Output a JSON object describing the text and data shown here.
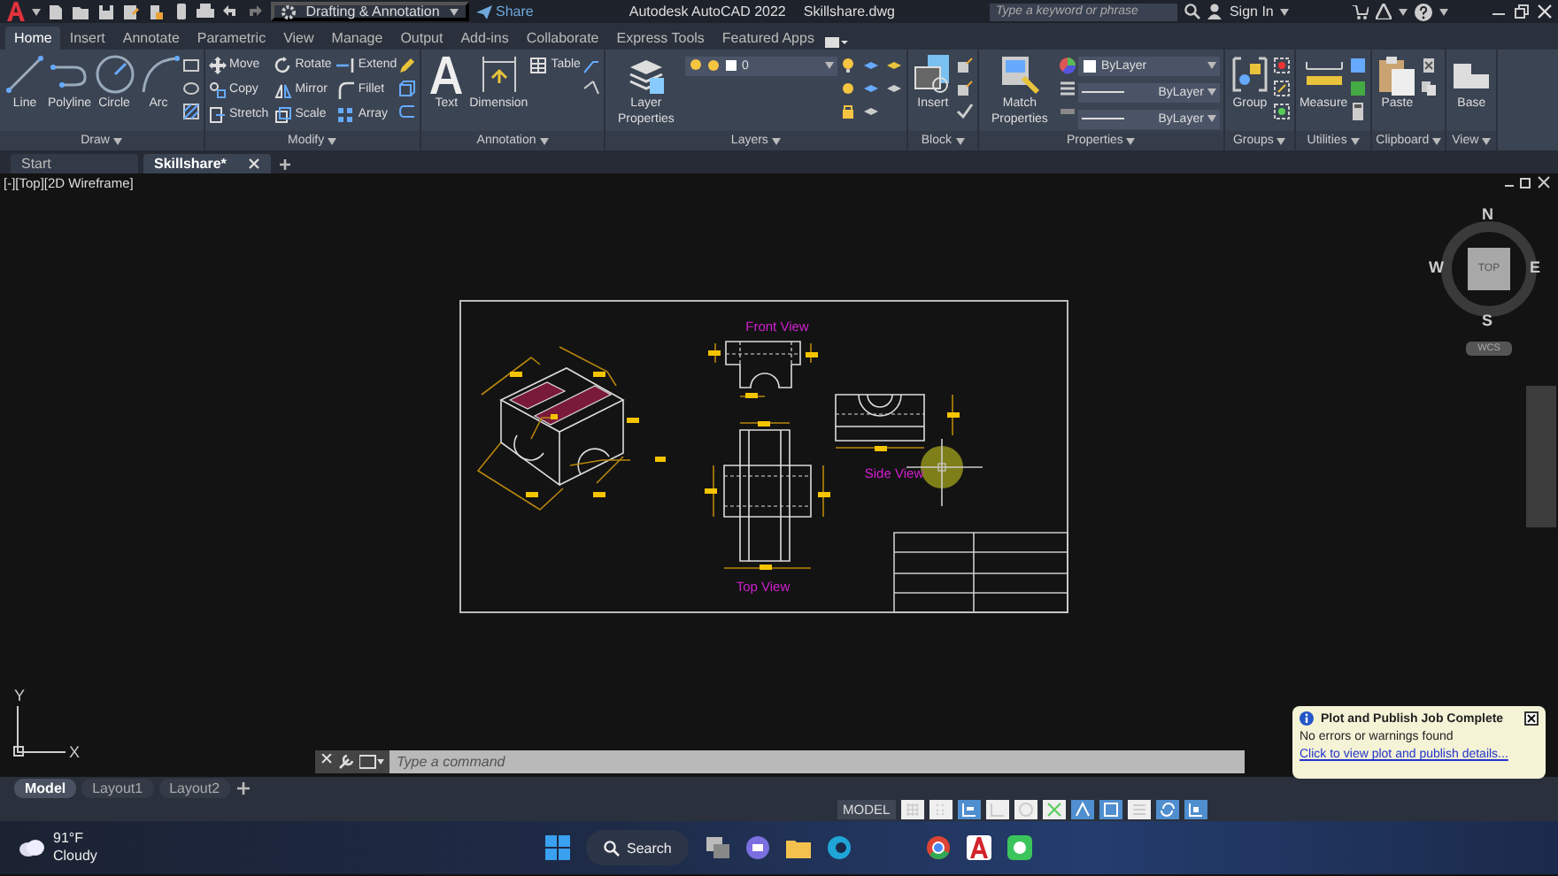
{
  "title_bar": {
    "workspace": "Drafting & Annotation",
    "share": "Share",
    "app_title": "Autodesk AutoCAD 2022",
    "file_name": "Skillshare.dwg",
    "search": {
      "placeholder": "Type a keyword or phrase"
    },
    "sign_in": "Sign In"
  },
  "ribbon_tabs": [
    {
      "label": "Home",
      "selected": true
    },
    {
      "label": "Insert",
      "selected": false
    },
    {
      "label": "Annotate",
      "selected": false
    },
    {
      "label": "Parametric",
      "selected": false
    },
    {
      "label": "View",
      "selected": false
    },
    {
      "label": "Manage",
      "selected": false
    },
    {
      "label": "Output",
      "selected": false
    },
    {
      "label": "Add-ins",
      "selected": false
    },
    {
      "label": "Collaborate",
      "selected": false
    },
    {
      "label": "Express Tools",
      "selected": false
    },
    {
      "label": "Featured Apps",
      "selected": false
    }
  ],
  "ribbon_panels": [
    {
      "title": "Draw",
      "tools": [
        {
          "kind": "large",
          "label": "Line"
        },
        {
          "kind": "large",
          "label": "Polyline"
        },
        {
          "kind": "large",
          "label": "Circle"
        },
        {
          "kind": "large",
          "label": "Arc"
        }
      ]
    },
    {
      "title": "Modify",
      "tools": [
        {
          "kind": "small",
          "label": "Move"
        },
        {
          "kind": "small",
          "label": "Rotate"
        },
        {
          "kind": "small",
          "label": "Extend"
        },
        {
          "kind": "small",
          "label": "Copy"
        },
        {
          "kind": "small",
          "label": "Mirror"
        },
        {
          "kind": "small",
          "label": "Fillet"
        },
        {
          "kind": "small",
          "label": "Stretch"
        },
        {
          "kind": "small",
          "label": "Scale"
        },
        {
          "kind": "small",
          "label": "Array"
        }
      ]
    },
    {
      "title": "Annotation",
      "tools": [
        {
          "kind": "large",
          "label": "Text"
        },
        {
          "kind": "large",
          "label": "Dimension"
        },
        {
          "kind": "small",
          "label": "Table"
        }
      ]
    },
    {
      "title": "Layers",
      "tools": [
        {
          "kind": "large",
          "label": "Layer Properties"
        },
        {
          "kind": "combo",
          "label": "0"
        }
      ]
    },
    {
      "title": "Block",
      "tools": [
        {
          "kind": "large",
          "label": "Insert"
        }
      ]
    },
    {
      "title": "Properties",
      "tools": [
        {
          "kind": "large",
          "label": "Match Properties"
        },
        {
          "kind": "combo",
          "label": "ByLayer"
        },
        {
          "kind": "combo",
          "label": "ByLayer"
        },
        {
          "kind": "combo",
          "label": "ByLayer"
        }
      ]
    },
    {
      "title": "Groups",
      "tools": [
        {
          "kind": "large",
          "label": "Group"
        }
      ]
    },
    {
      "title": "Utilities",
      "tools": [
        {
          "kind": "large",
          "label": "Measure"
        }
      ]
    },
    {
      "title": "Clipboard",
      "tools": [
        {
          "kind": "large",
          "label": "Paste"
        }
      ]
    },
    {
      "title": "View",
      "tools": [
        {
          "kind": "large",
          "label": "Base"
        }
      ]
    }
  ],
  "file_tabs": [
    {
      "label": "Start",
      "selected": false
    },
    {
      "label": "Skillshare*",
      "selected": true
    }
  ],
  "viewport": {
    "label": "[-][Top][2D Wireframe]",
    "view_labels": [
      "Front View",
      "Side View",
      "Top View"
    ],
    "viewcube": {
      "face": "TOP",
      "north": "N",
      "south": "S",
      "east": "E",
      "west": "W",
      "ucs": "WCS"
    },
    "axes": {
      "x": "X",
      "y": "Y"
    }
  },
  "command_line": {
    "placeholder": "Type a command"
  },
  "notification": {
    "title": "Plot and Publish Job Complete",
    "message": "No errors or warnings found",
    "link": "Click to view plot and publish details..."
  },
  "layout_tabs": [
    {
      "label": "Model",
      "selected": true
    },
    {
      "label": "Layout1",
      "selected": false
    },
    {
      "label": "Layout2",
      "selected": false
    }
  ],
  "status_bar": {
    "mode": "MODEL",
    "toggles": [
      {
        "on": false
      },
      {
        "on": false
      },
      {
        "on": true
      },
      {
        "on": false
      },
      {
        "on": false
      },
      {
        "on": false
      },
      {
        "on": true
      },
      {
        "on": true
      },
      {
        "on": false
      },
      {
        "on": true
      },
      {
        "on": true
      }
    ]
  },
  "taskbar": {
    "temperature": "91°F",
    "condition": "Cloudy",
    "search": "Search"
  }
}
